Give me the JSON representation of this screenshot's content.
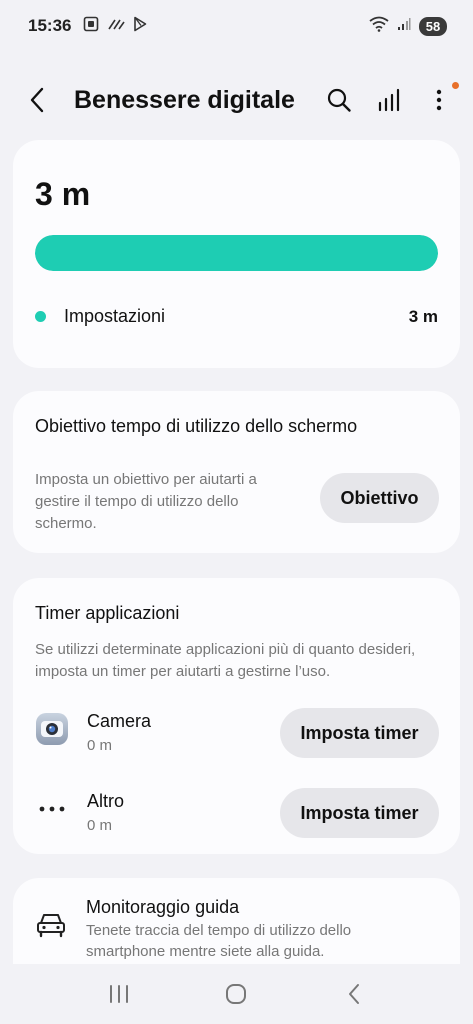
{
  "status": {
    "time": "15:36",
    "battery": "58"
  },
  "header": {
    "title": "Benessere digitale"
  },
  "usage": {
    "total": "3 m",
    "fill_fraction": 1.0,
    "accent_color": "#1ecdb3",
    "legend": [
      {
        "name": "Impostazioni",
        "value": "3 m"
      }
    ]
  },
  "goal": {
    "title": "Obiettivo tempo di utilizzo dello schermo",
    "description": "Imposta un obiettivo per aiutarti a gestire il tempo di utilizzo dello schermo.",
    "button_label": "Obiettivo"
  },
  "timers": {
    "title": "Timer applicazioni",
    "description": "Se utilizzi determinate applicazioni più di quanto desideri, imposta un timer per aiutarti a gestirne l’uso.",
    "apps": [
      {
        "name": "Camera",
        "time": "0 m",
        "icon": "camera-icon",
        "button_label": "Imposta timer"
      },
      {
        "name": "Altro",
        "time": "0 m",
        "icon": "more-horizontal-icon",
        "button_label": "Imposta timer"
      }
    ]
  },
  "driving": {
    "title": "Monitoraggio guida",
    "description": "Tenete traccia del tempo di utilizzo dello smartphone mentre siete alla guida."
  }
}
